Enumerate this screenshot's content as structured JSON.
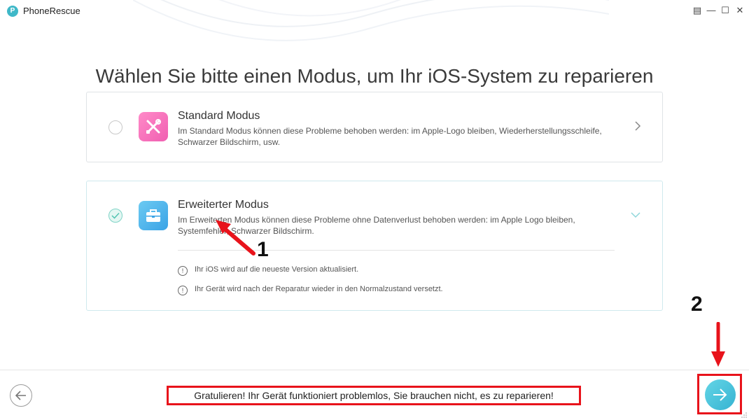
{
  "window": {
    "title": "PhoneRescue",
    "logo_letter": "P",
    "controls": {
      "menu": "▤",
      "minimize": "—",
      "maximize": "☐",
      "close": "✕"
    }
  },
  "page": {
    "title": "Wählen Sie bitte einen Modus, um Ihr iOS-System zu reparieren"
  },
  "modes": [
    {
      "title": "Standard Modus",
      "description": "Im Standard Modus können diese Probleme behoben werden: im Apple-Logo bleiben, Wiederherstellungsschleife, Schwarzer Bildschirm, usw.",
      "selected": false,
      "icon": "tools-icon"
    },
    {
      "title": "Erweiterter Modus",
      "description": "Im Erweiterten Modus können diese Probleme ohne Datenverlust behoben werden: im Apple Logo bleiben, Systemfehler, Schwarzer Bildschirm.",
      "selected": true,
      "icon": "toolbox-icon",
      "notes": [
        "Ihr iOS wird auf die neueste Version aktualisiert.",
        "Ihr Gerät wird nach der Reparatur wieder in den Normalzustand versetzt."
      ]
    }
  ],
  "footer": {
    "status_message": "Gratulieren! Ihr Gerät funktioniert problemlos, Sie brauchen nicht, es zu reparieren!"
  },
  "annotations": {
    "step1": "1",
    "step2": "2"
  },
  "colors": {
    "accent": "#3fb8c8",
    "annotation": "#e8131b",
    "pink_icon": "#f05fb1",
    "blue_icon": "#3aa3e6"
  }
}
